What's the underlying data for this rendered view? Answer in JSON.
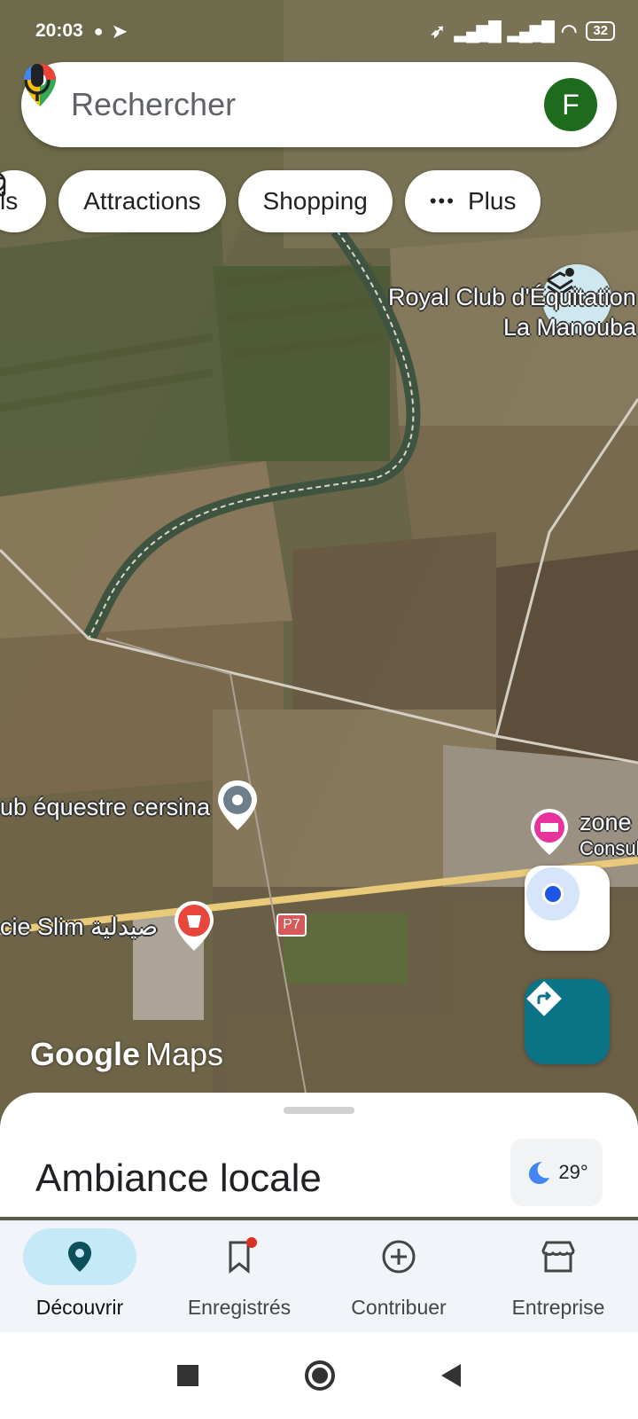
{
  "status_bar": {
    "time": "20:03",
    "battery": "32"
  },
  "search": {
    "placeholder": "Rechercher",
    "avatar_initial": "F"
  },
  "chips": [
    {
      "label": "ls",
      "icon": "partial-chip"
    },
    {
      "label": "Attractions",
      "icon": "ferris-wheel-icon"
    },
    {
      "label": "Shopping",
      "icon": "shopping-bag-icon"
    },
    {
      "label": "Plus",
      "icon": "more-dots-icon"
    }
  ],
  "map_labels": {
    "royal_club_line1": "Royal Club d'Équitation",
    "royal_club_line2": "La Manouba",
    "club_equestre": "ub équestre cersina",
    "zone": "zone",
    "consul": "Consul",
    "pharmacie": "cie Slim صيدلية",
    "road": "P7"
  },
  "attribution": {
    "google": "Google",
    "maps": "Maps"
  },
  "sheet": {
    "title": "Ambiance locale",
    "weather_temp": "29°"
  },
  "bottom_nav": [
    {
      "label": "Découvrir",
      "icon": "location-pin-icon",
      "active": true
    },
    {
      "label": "Enregistrés",
      "icon": "bookmark-icon",
      "active": false
    },
    {
      "label": "Contribuer",
      "icon": "add-circle-icon",
      "active": false
    },
    {
      "label": "Entreprise",
      "icon": "storefront-icon",
      "active": false
    }
  ],
  "colors": {
    "accent": "#0b7386",
    "active_nav_bg": "#c5e9f6",
    "avatar": "#1e6b1e"
  }
}
